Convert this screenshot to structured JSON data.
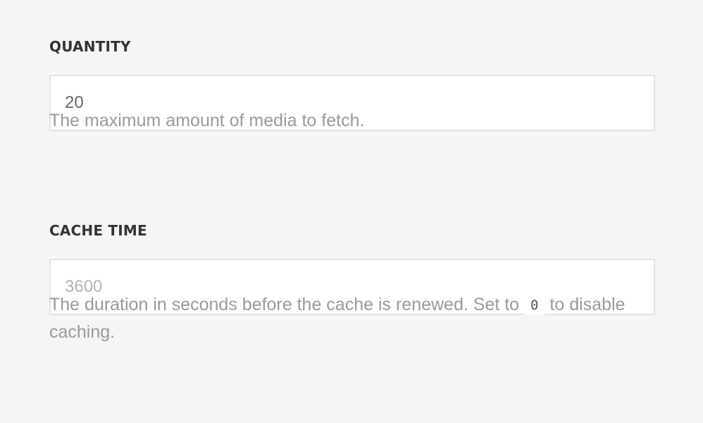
{
  "fields": {
    "quantity": {
      "label": "QUANTITY",
      "value": "20",
      "help": "The maximum amount of media to fetch."
    },
    "cache_time": {
      "label": "CACHE TIME",
      "placeholder": "3600",
      "help_before": "The duration in seconds before the cache is renewed. Set to ",
      "help_code": "0",
      "help_after": " to disable caching."
    }
  },
  "colors": {
    "background": "#f5f5f5",
    "label": "#333333",
    "help_text": "#9a9a9a",
    "input_border": "#e3e3e3",
    "input_bg": "#ffffff"
  }
}
